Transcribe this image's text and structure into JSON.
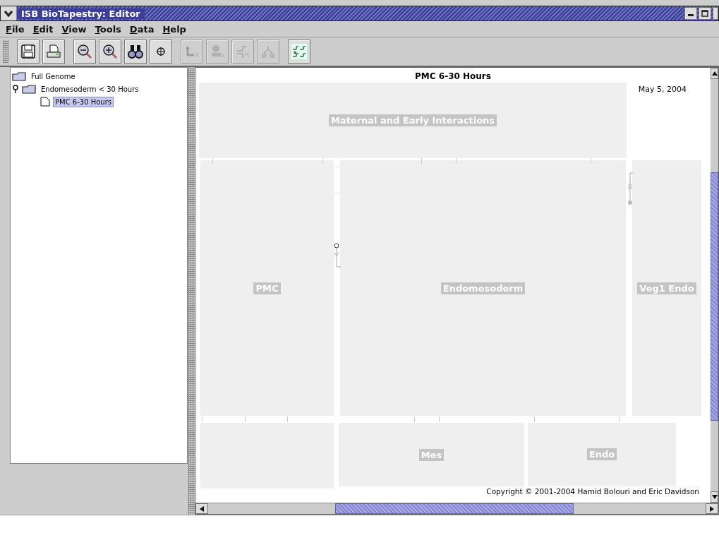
{
  "window": {
    "title": "ISB BioTapestry: Editor"
  },
  "menu": [
    "File",
    "Edit",
    "View",
    "Tools",
    "Data",
    "Help"
  ],
  "toolbar": [
    [
      {
        "kind": "save",
        "disabled": false
      },
      {
        "kind": "print",
        "disabled": false
      }
    ],
    [
      {
        "kind": "zoom-out",
        "disabled": false
      },
      {
        "kind": "zoom-in",
        "disabled": false
      },
      {
        "kind": "find",
        "disabled": false
      },
      {
        "kind": "center",
        "disabled": false
      }
    ],
    [
      {
        "kind": "link",
        "disabled": true
      },
      {
        "kind": "node",
        "disabled": true
      },
      {
        "kind": "split",
        "disabled": true
      },
      {
        "kind": "branch",
        "disabled": true
      }
    ],
    [
      {
        "kind": "tune",
        "disabled": false
      }
    ]
  ],
  "tree": [
    {
      "label": "Full Genome",
      "selected": false,
      "expanded": false
    },
    {
      "label": "Endomesoderm < 30 Hours",
      "selected": false,
      "expanded": true,
      "children": [
        {
          "label": "PMC 6-30 Hours",
          "selected": true
        }
      ]
    }
  ],
  "canvas": {
    "title": "PMC 6-30 Hours",
    "date": "May 5, 2004",
    "copyright": "Copyright © 2001-2004 Hamid Bolouri and Eric Davidson",
    "regions": [
      {
        "kind": "labeled",
        "label": "Maternal and Early Interactions"
      },
      {
        "kind": "labeled",
        "label": "PMC"
      },
      {
        "kind": "labeled",
        "label": "Endomesoderm"
      },
      {
        "kind": "labeled",
        "label": "Veg1 Endo"
      },
      {
        "kind": "blank"
      },
      {
        "kind": "labeled",
        "label": "Mes"
      },
      {
        "kind": "labeled",
        "label": "Endo"
      }
    ]
  }
}
